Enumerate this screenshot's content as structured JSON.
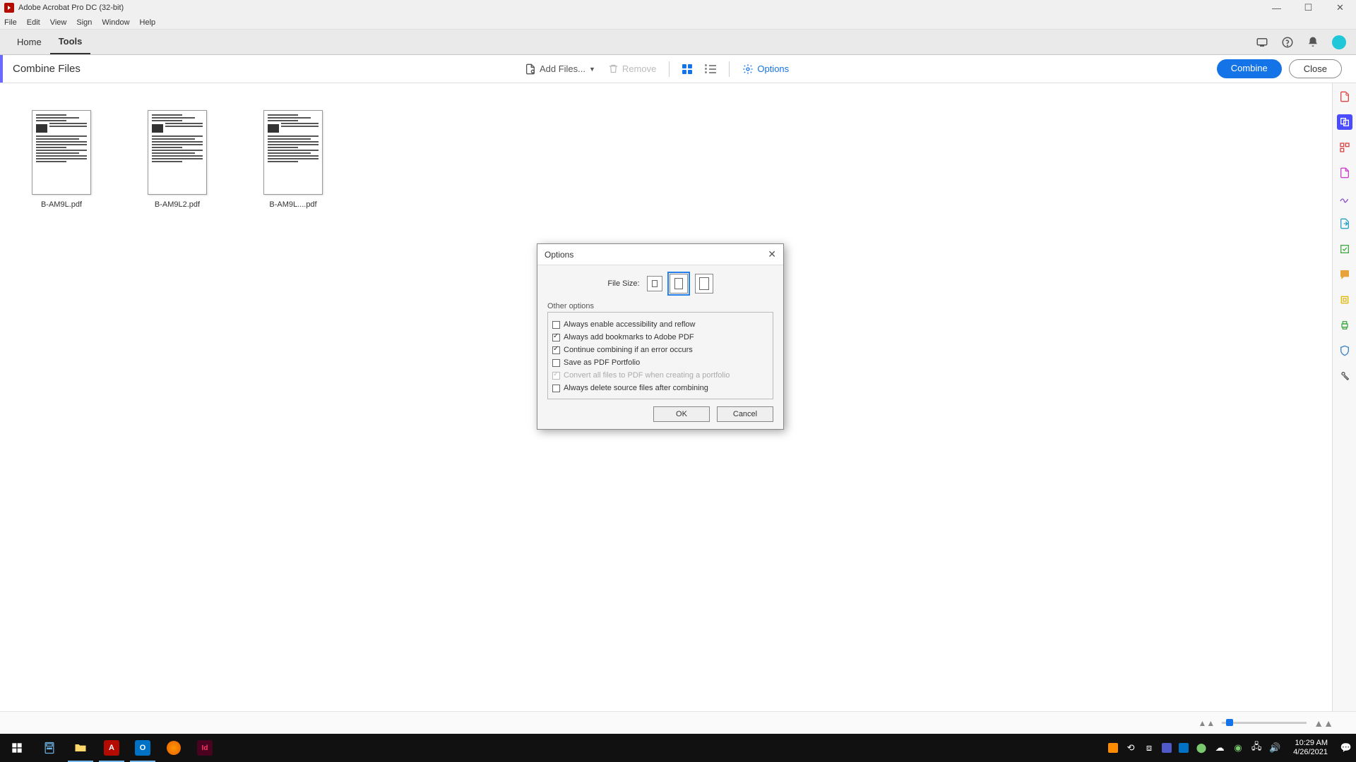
{
  "window": {
    "title": "Adobe Acrobat Pro DC (32-bit)"
  },
  "menu": {
    "items": [
      "File",
      "Edit",
      "View",
      "Sign",
      "Window",
      "Help"
    ]
  },
  "tabs": {
    "home": "Home",
    "tools": "Tools"
  },
  "toolbar": {
    "title": "Combine Files",
    "add_files": "Add Files...",
    "remove": "Remove",
    "options": "Options",
    "combine": "Combine",
    "close": "Close"
  },
  "files": [
    {
      "name": "B-AM9L.pdf"
    },
    {
      "name": "B-AM9L2.pdf"
    },
    {
      "name": "B-AM9L....pdf"
    }
  ],
  "dialog": {
    "title": "Options",
    "file_size_label": "File Size:",
    "other_options": "Other options",
    "opt_accessibility": "Always enable accessibility and reflow",
    "opt_bookmarks": "Always add bookmarks to Adobe PDF",
    "opt_continue": "Continue combining if an error occurs",
    "opt_portfolio": "Save as PDF Portfolio",
    "opt_convert_all": "Convert all files to PDF when creating a portfolio",
    "opt_delete_source": "Always delete source files after combining",
    "ok": "OK",
    "cancel": "Cancel"
  },
  "tray": {
    "time": "10:29 AM",
    "date": "4/26/2021"
  }
}
